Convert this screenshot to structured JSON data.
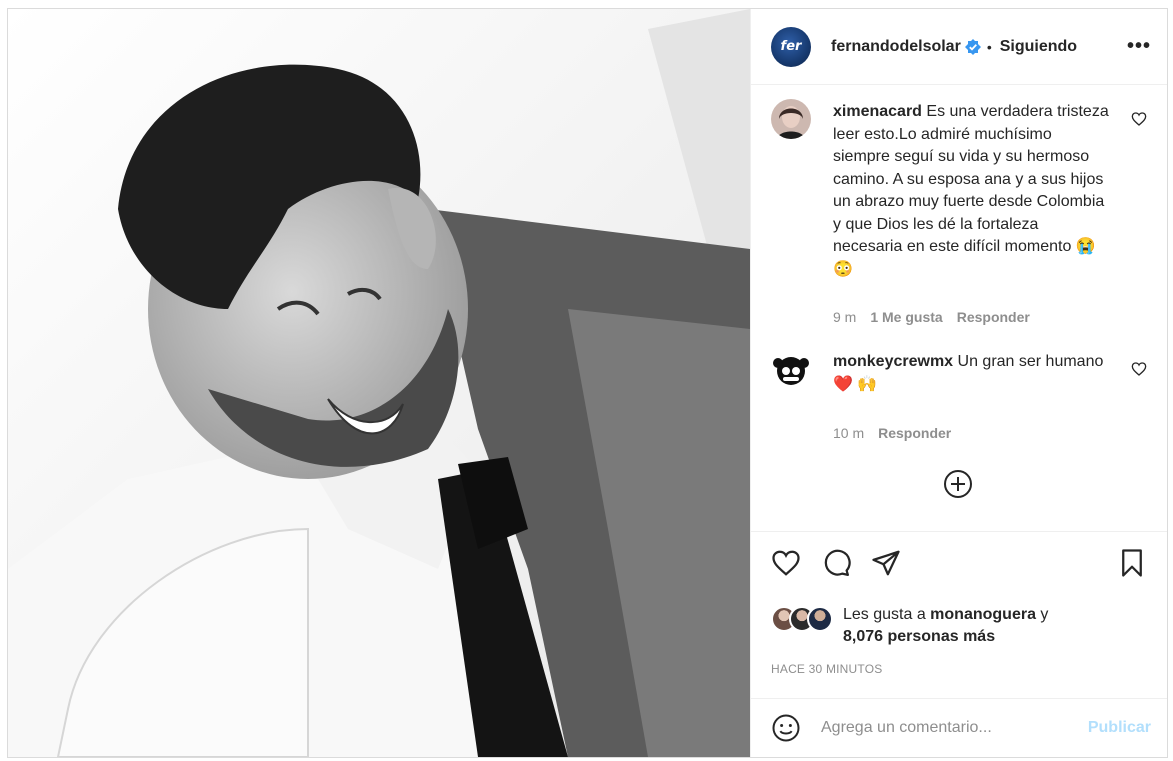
{
  "header": {
    "username": "fernandodelsolar",
    "avatar_text": "fer",
    "separator": "•",
    "follow_status": "Siguiendo",
    "more_label": "•••"
  },
  "comments": [
    {
      "user": "ximenacard",
      "text": "Es una verdadera tristeza leer esto.Lo admiré muchísimo siempre seguí su vida y su hermoso camino. A su esposa ana y a sus hijos un abrazo muy fuerte desde Colombia y que Dios les dé la fortaleza necesaria en este difícil momento 😭 😳",
      "time": "9 m",
      "likes": "1 Me gusta",
      "reply": "Responder"
    },
    {
      "user": "monkeycrewmx",
      "text": "Un gran ser humano ❤️ 🙌",
      "time": "10 m",
      "reply": "Responder"
    }
  ],
  "likes": {
    "prefix": "Les gusta a ",
    "user": "monanoguera",
    "connector": " y",
    "others": "8,076 personas más"
  },
  "timestamp": "HACE 30 MINUTOS",
  "add_comment": {
    "placeholder": "Agrega un comentario...",
    "publish_label": "Publicar"
  },
  "colors": {
    "verified": "#3897f0",
    "publish": "#b2dffc",
    "heart_emoji": "#ed4956"
  }
}
